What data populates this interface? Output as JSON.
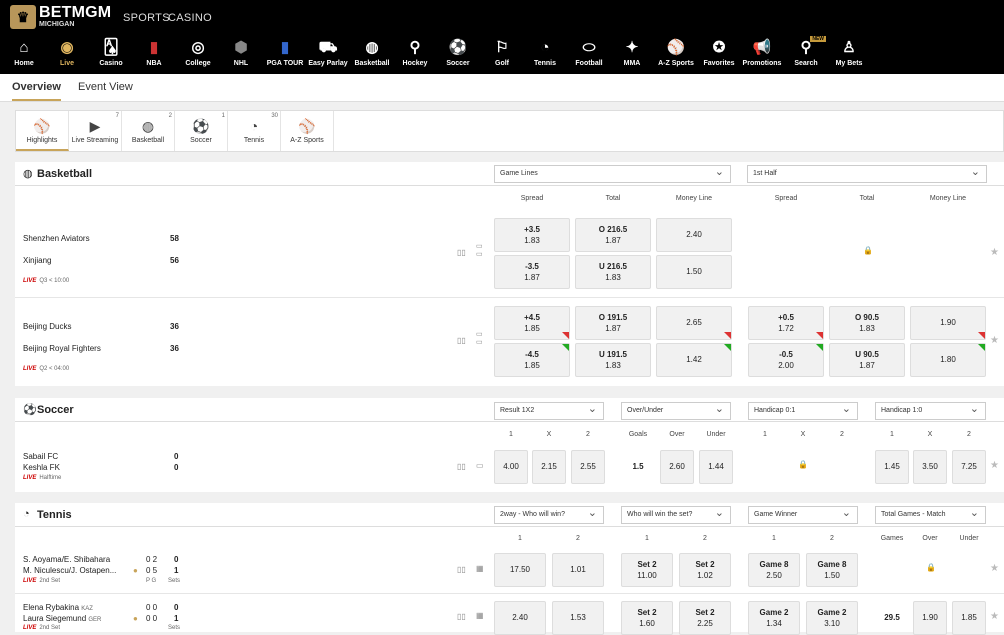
{
  "header": {
    "brand": "BETMGM",
    "state": "MICHIGAN",
    "nav": [
      "SPORTS",
      "CASINO"
    ]
  },
  "sports": [
    {
      "label": "Home",
      "icon": "home-icon"
    },
    {
      "label": "Live",
      "icon": "live-icon"
    },
    {
      "label": "Casino",
      "icon": "casino-icon"
    },
    {
      "label": "NBA",
      "icon": "nba-icon"
    },
    {
      "label": "College",
      "icon": "college-icon"
    },
    {
      "label": "NHL",
      "icon": "nhl-icon"
    },
    {
      "label": "PGA TOUR",
      "icon": "pga-icon"
    },
    {
      "label": "Easy Parlay",
      "icon": "easy-parlay-icon"
    },
    {
      "label": "Basketball",
      "icon": "basketball-icon"
    },
    {
      "label": "Hockey",
      "icon": "hockey-icon"
    },
    {
      "label": "Soccer",
      "icon": "soccer-icon"
    },
    {
      "label": "Golf",
      "icon": "golf-icon"
    },
    {
      "label": "Tennis",
      "icon": "tennis-icon"
    },
    {
      "label": "Football",
      "icon": "football-icon"
    },
    {
      "label": "MMA",
      "icon": "mma-icon"
    },
    {
      "label": "A-Z Sports",
      "icon": "az-sports-icon"
    },
    {
      "label": "Favorites",
      "icon": "favorites-icon"
    },
    {
      "label": "Promotions",
      "icon": "promotions-icon"
    },
    {
      "label": "Search",
      "icon": "search-icon",
      "badge": "NEW"
    },
    {
      "label": "My Bets",
      "icon": "my-bets-icon"
    }
  ],
  "subnav": [
    "Overview",
    "Event View"
  ],
  "filters": [
    {
      "label": "Highlights",
      "count": ""
    },
    {
      "label": "Live Streaming",
      "count": "7"
    },
    {
      "label": "Basketball",
      "count": "2"
    },
    {
      "label": "Soccer",
      "count": "1"
    },
    {
      "label": "Tennis",
      "count": "30"
    },
    {
      "label": "A-Z Sports",
      "count": ""
    }
  ],
  "basketball": {
    "title": "Basketball",
    "select1": "Game Lines",
    "select2": "1st Half",
    "cols": [
      "Spread",
      "Total",
      "Money Line",
      "Spread",
      "Total",
      "Money Line"
    ],
    "games": [
      {
        "team1": "Shenzhen Aviators",
        "score1": "58",
        "team2": "Xinjiang",
        "score2": "56",
        "live": "LIVE",
        "status": "Q3 < 10:00",
        "spread": [
          [
            "+3.5",
            "1.83"
          ],
          [
            "-3.5",
            "1.87"
          ]
        ],
        "total": [
          [
            "O 216.5",
            "1.87"
          ],
          [
            "U 216.5",
            "1.83"
          ]
        ],
        "ml": [
          "2.40",
          "1.50"
        ]
      },
      {
        "team1": "Beijing Ducks",
        "score1": "36",
        "team2": "Beijing Royal Fighters",
        "score2": "36",
        "live": "LIVE",
        "status": "Q2 < 04:00",
        "spread": [
          [
            "+4.5",
            "1.85"
          ],
          [
            "-4.5",
            "1.85"
          ]
        ],
        "total": [
          [
            "O 191.5",
            "1.87"
          ],
          [
            "U 191.5",
            "1.83"
          ]
        ],
        "ml": [
          "2.65",
          "1.42"
        ],
        "h_spread": [
          [
            "+0.5",
            "1.72"
          ],
          [
            "-0.5",
            "2.00"
          ]
        ],
        "h_total": [
          [
            "O 90.5",
            "1.83"
          ],
          [
            "U 90.5",
            "1.87"
          ]
        ],
        "h_ml": [
          "1.90",
          "1.80"
        ]
      }
    ]
  },
  "soccer": {
    "title": "Soccer",
    "selects": [
      "Result 1X2",
      "Over/Under",
      "Handicap 0:1",
      "Handicap 1:0"
    ],
    "cols": [
      "1",
      "X",
      "2",
      "Goals",
      "Over",
      "Under",
      "1",
      "X",
      "2",
      "1",
      "X",
      "2"
    ],
    "team1": "Sabail FC",
    "score1": "0",
    "team2": "Keshla FK",
    "score2": "0",
    "live": "LIVE",
    "status": "Halftime",
    "result": [
      "4.00",
      "2.15",
      "2.55"
    ],
    "goals": "1.5",
    "ou": [
      "2.60",
      "1.44"
    ],
    "h10": [
      "1.45",
      "3.50",
      "7.25"
    ]
  },
  "tennis": {
    "title": "Tennis",
    "selects": [
      "2way - Who will win?",
      "Who will win the set?",
      "Game Winner",
      "Total Games - Match"
    ],
    "cols": [
      "1",
      "2",
      "1",
      "2",
      "1",
      "2",
      "Games",
      "Over",
      "Under"
    ],
    "matches": [
      {
        "p1": "S. Aoyama/E. Shibahara",
        "p1s": "0 2",
        "p1sets": "0",
        "p2": "M. Niculescu/J. Ostapen...",
        "p2s": "0 5",
        "p2sets": "1",
        "live": "LIVE",
        "status": "2nd Set",
        "pc": "P G",
        "sets": "Sets",
        "win": [
          "17.50",
          "1.01"
        ],
        "set": [
          [
            "Set 2",
            "11.00"
          ],
          [
            "Set 2",
            "1.02"
          ]
        ],
        "game": [
          [
            "Game 8",
            "2.50"
          ],
          [
            "Game 8",
            "1.50"
          ]
        ]
      },
      {
        "p1": "Elena Rybakina",
        "p1c": "KAZ",
        "p1s": "0 0",
        "p1sets": "0",
        "p2": "Laura Siegemund",
        "p2c": "GER",
        "p2s": "0 0",
        "p2sets": "1",
        "live": "LIVE",
        "status": "2nd Set",
        "sets": "Sets",
        "win": [
          "2.40",
          "1.53"
        ],
        "set": [
          [
            "Set 2",
            "1.60"
          ],
          [
            "Set 2",
            "2.25"
          ]
        ],
        "game": [
          [
            "Game 2",
            "1.34"
          ],
          [
            "Game 2",
            "3.10"
          ]
        ],
        "games": "29.5",
        "ou": [
          "1.90",
          "1.85"
        ]
      }
    ]
  }
}
